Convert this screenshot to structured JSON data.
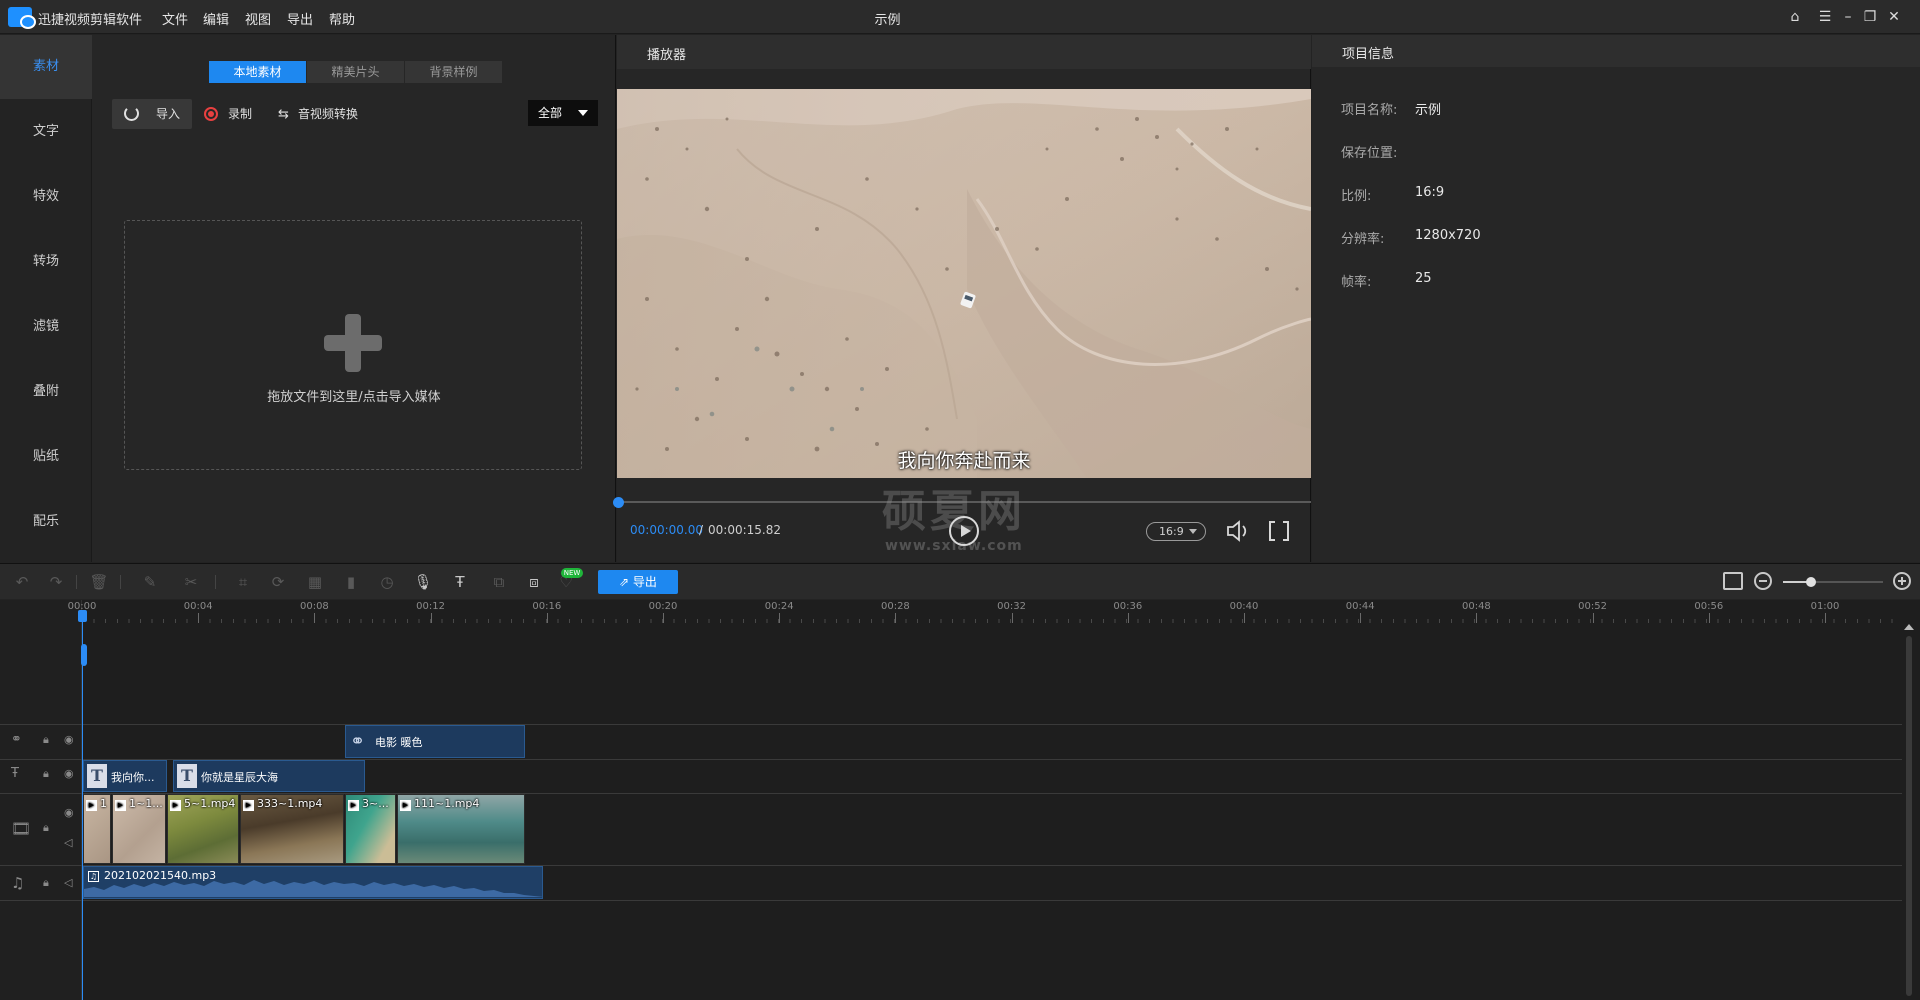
{
  "titlebar": {
    "app_name": "迅捷视频剪辑软件",
    "menus": [
      "文件",
      "编辑",
      "视图",
      "导出",
      "帮助"
    ],
    "window_title": "示例"
  },
  "sidebar": {
    "items": [
      {
        "label": "素材",
        "active": true
      },
      {
        "label": "文字"
      },
      {
        "label": "特效"
      },
      {
        "label": "转场"
      },
      {
        "label": "滤镜"
      },
      {
        "label": "叠附"
      },
      {
        "label": "贴纸"
      },
      {
        "label": "配乐"
      }
    ]
  },
  "media": {
    "tabs": [
      "本地素材",
      "精美片头",
      "背景样例"
    ],
    "active_tab": 0,
    "import_label": "导入",
    "record_label": "录制",
    "convert_label": "音视频转换",
    "filter_value": "全部",
    "drop_text": "拖放文件到这里/点击导入媒体"
  },
  "player": {
    "title": "播放器",
    "subtitle": "我向你奔赴而来",
    "time_current": "00:00:00.00",
    "time_separator": "/",
    "time_total": "00:00:15.82",
    "ratio": "16:9",
    "progress": 0,
    "watermark": "硕夏网",
    "watermark_url": "www.sxiaw.com"
  },
  "project_info": {
    "title": "项目信息",
    "rows": [
      {
        "label": "项目名称:",
        "value": "示例"
      },
      {
        "label": "保存位置:",
        "value": ""
      },
      {
        "label": "比例:",
        "value": "16:9"
      },
      {
        "label": "分辨率:",
        "value": "1280x720"
      },
      {
        "label": "帧率:",
        "value": "25"
      }
    ]
  },
  "toolbar": {
    "export_label": "导出",
    "new_badge": "NEW",
    "zoom_level": 0.28
  },
  "timeline": {
    "ruler": [
      "00:00",
      "00:04",
      "00:08",
      "00:12",
      "00:16",
      "00:20",
      "00:24",
      "00:28",
      "00:32",
      "00:36",
      "00:40",
      "00:44",
      "00:48",
      "00:52",
      "00:56",
      "01:00"
    ],
    "filter_clip": "电影 暖色",
    "text_clips": [
      "我向你...",
      "你就是星辰大海"
    ],
    "video_clips": [
      "1",
      "1~1...",
      "5~1.mp4",
      "333~1.mp4",
      "3~...",
      "111~1.mp4"
    ],
    "audio_clip": "202102021540.mp3"
  },
  "colors": {
    "accent": "#1e88f0",
    "clip_fill": "#1d3a5e",
    "record": "#e84040",
    "new_badge": "#1fb53a"
  }
}
